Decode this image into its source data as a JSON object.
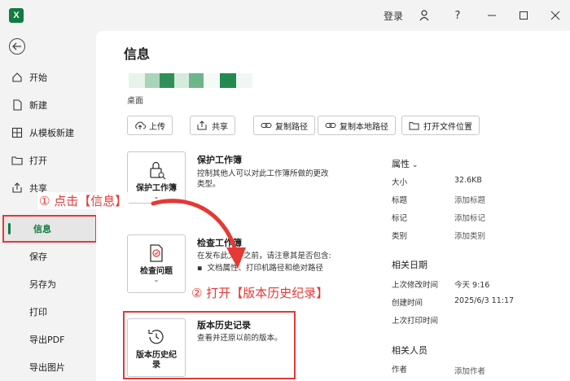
{
  "titlebar": {
    "app_letter": "X",
    "login": "登录",
    "help": "?"
  },
  "sidebar": {
    "items": [
      {
        "label": "开始",
        "icon": "home-icon"
      },
      {
        "label": "新建",
        "icon": "new-doc-icon"
      },
      {
        "label": "从模板新建",
        "icon": "template-icon"
      },
      {
        "label": "打开",
        "icon": "folder-icon"
      },
      {
        "label": "共享",
        "icon": "share-icon"
      },
      {
        "label": "信息"
      },
      {
        "label": "保存"
      },
      {
        "label": "另存为"
      },
      {
        "label": "打印"
      },
      {
        "label": "导出PDF"
      },
      {
        "label": "导出图片"
      }
    ],
    "active_index": 5
  },
  "main": {
    "title": "信息",
    "file_location": "桌面",
    "actions": [
      {
        "label": "上传",
        "icon": "cloud-upload-icon"
      },
      {
        "label": "共享",
        "icon": "share-icon"
      },
      {
        "label": "复制路径",
        "icon": "link-icon"
      },
      {
        "label": "复制本地路径",
        "icon": "link-icon"
      },
      {
        "label": "打开文件位置",
        "icon": "folder-icon"
      }
    ],
    "protect": {
      "button": "保护工作簿",
      "title": "保护工作簿",
      "desc_line1": "控制其他人可以对此工作簿所做的更改",
      "desc_line2": "类型。"
    },
    "inspect": {
      "button": "检查问题",
      "title": "检查工作簿",
      "desc": "在发布此文件之前，请注意其是否包含:",
      "bullet": "文档属性、打印机路径和绝对路径"
    },
    "history": {
      "button_line1": "版本历史纪",
      "button_line2": "录",
      "title": "版本历史记录",
      "desc": "查看并还原以前的版本。"
    }
  },
  "properties": {
    "title": "属性",
    "rows": [
      {
        "key": "大小",
        "value": "32.6KB"
      },
      {
        "key": "标题",
        "value": "添加标题"
      },
      {
        "key": "标记",
        "value": "添加标记"
      },
      {
        "key": "类别",
        "value": "添加类别"
      }
    ],
    "dates_title": "相关日期",
    "dates": [
      {
        "key": "上次修改时间",
        "value": "今天 9:16"
      },
      {
        "key": "创建时间",
        "value": "2025/6/3 11:17"
      },
      {
        "key": "上次打印时间",
        "value": ""
      }
    ],
    "people_title": "相关人员",
    "people": [
      {
        "key": "作者",
        "value": "添加作者"
      }
    ]
  },
  "annotations": {
    "step1": "① 点击【信息】",
    "step2": "② 打开【版本历史纪录】"
  },
  "colors": {
    "accent": "#107c41",
    "annotation": "#e53935"
  }
}
